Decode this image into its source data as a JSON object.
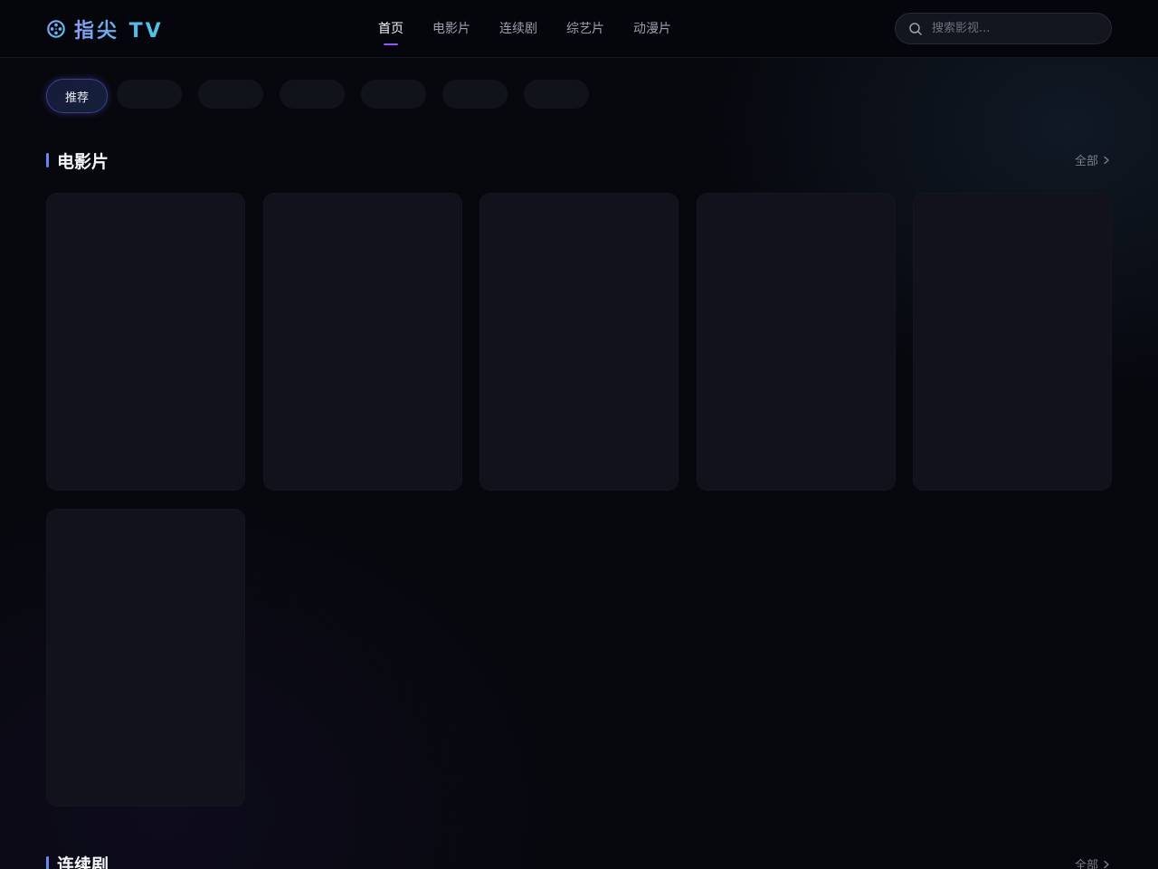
{
  "brand": {
    "name": "指尖 TV",
    "icon": "film-reel-icon",
    "accent_from": "#8b9cf6",
    "accent_to": "#4cc3e4"
  },
  "nav": {
    "items": [
      {
        "label": "首页",
        "active": true
      },
      {
        "label": "电影片",
        "active": false
      },
      {
        "label": "连续剧",
        "active": false
      },
      {
        "label": "综艺片",
        "active": false
      },
      {
        "label": "动漫片",
        "active": false
      }
    ],
    "active_indicator_color": "#8b5cf6"
  },
  "search": {
    "placeholder": "搜索影视...",
    "value": "",
    "icon": "search-icon"
  },
  "filters": {
    "active_label": "推荐",
    "placeholder_count": 6
  },
  "sections": [
    {
      "title": "电影片",
      "see_all_label": "全部",
      "see_all_icon": "chevron-right-icon",
      "card_count": 6
    },
    {
      "title": "连续剧",
      "see_all_label": "全部",
      "see_all_icon": "chevron-right-icon"
    }
  ],
  "colors": {
    "background": "#07080e",
    "card": "#11121b",
    "section_bar": "#7c83f5"
  }
}
